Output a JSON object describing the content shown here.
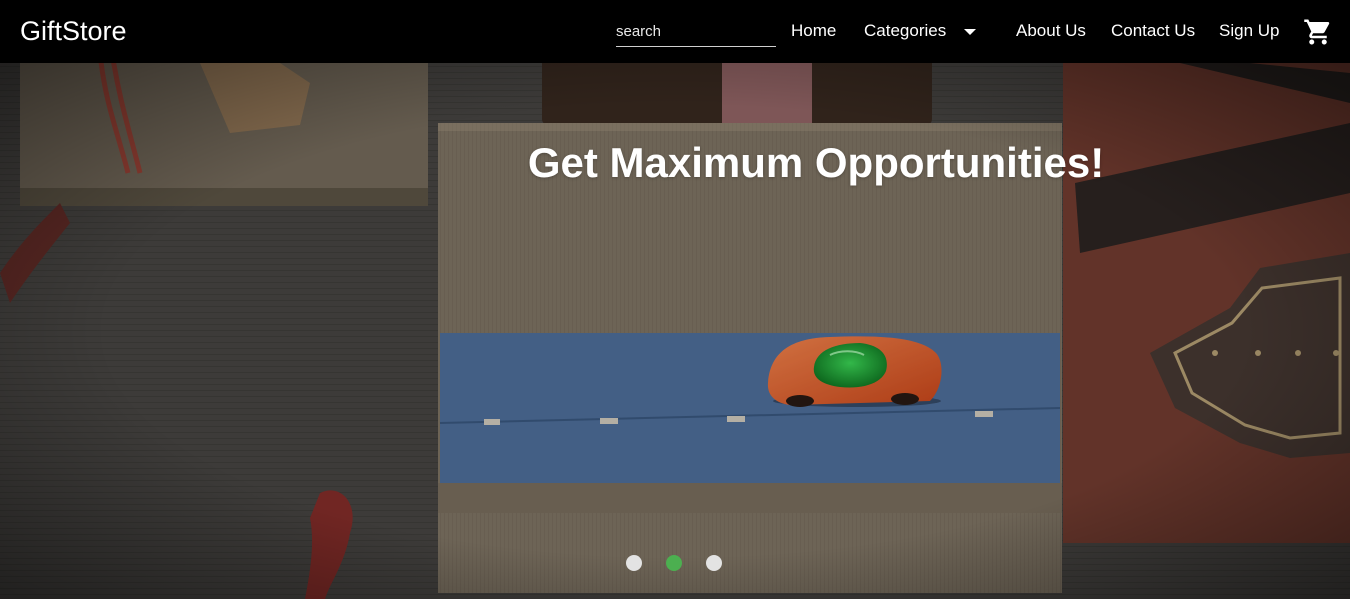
{
  "navbar": {
    "brand": "GiftStore",
    "search_placeholder": "search",
    "links": {
      "home": "Home",
      "categories": "Categories",
      "about": "About Us",
      "contact": "Contact Us",
      "signup": "Sign Up"
    },
    "icons": {
      "dropdown": "caret-down-icon",
      "cart": "shopping-cart-icon"
    }
  },
  "carousel": {
    "headline": "Get Maximum Opportunities!",
    "slide_count": 3,
    "active_slide": 2,
    "active_dot_color": "#4caf50",
    "inactive_dot_color": "#e3e3e3"
  }
}
